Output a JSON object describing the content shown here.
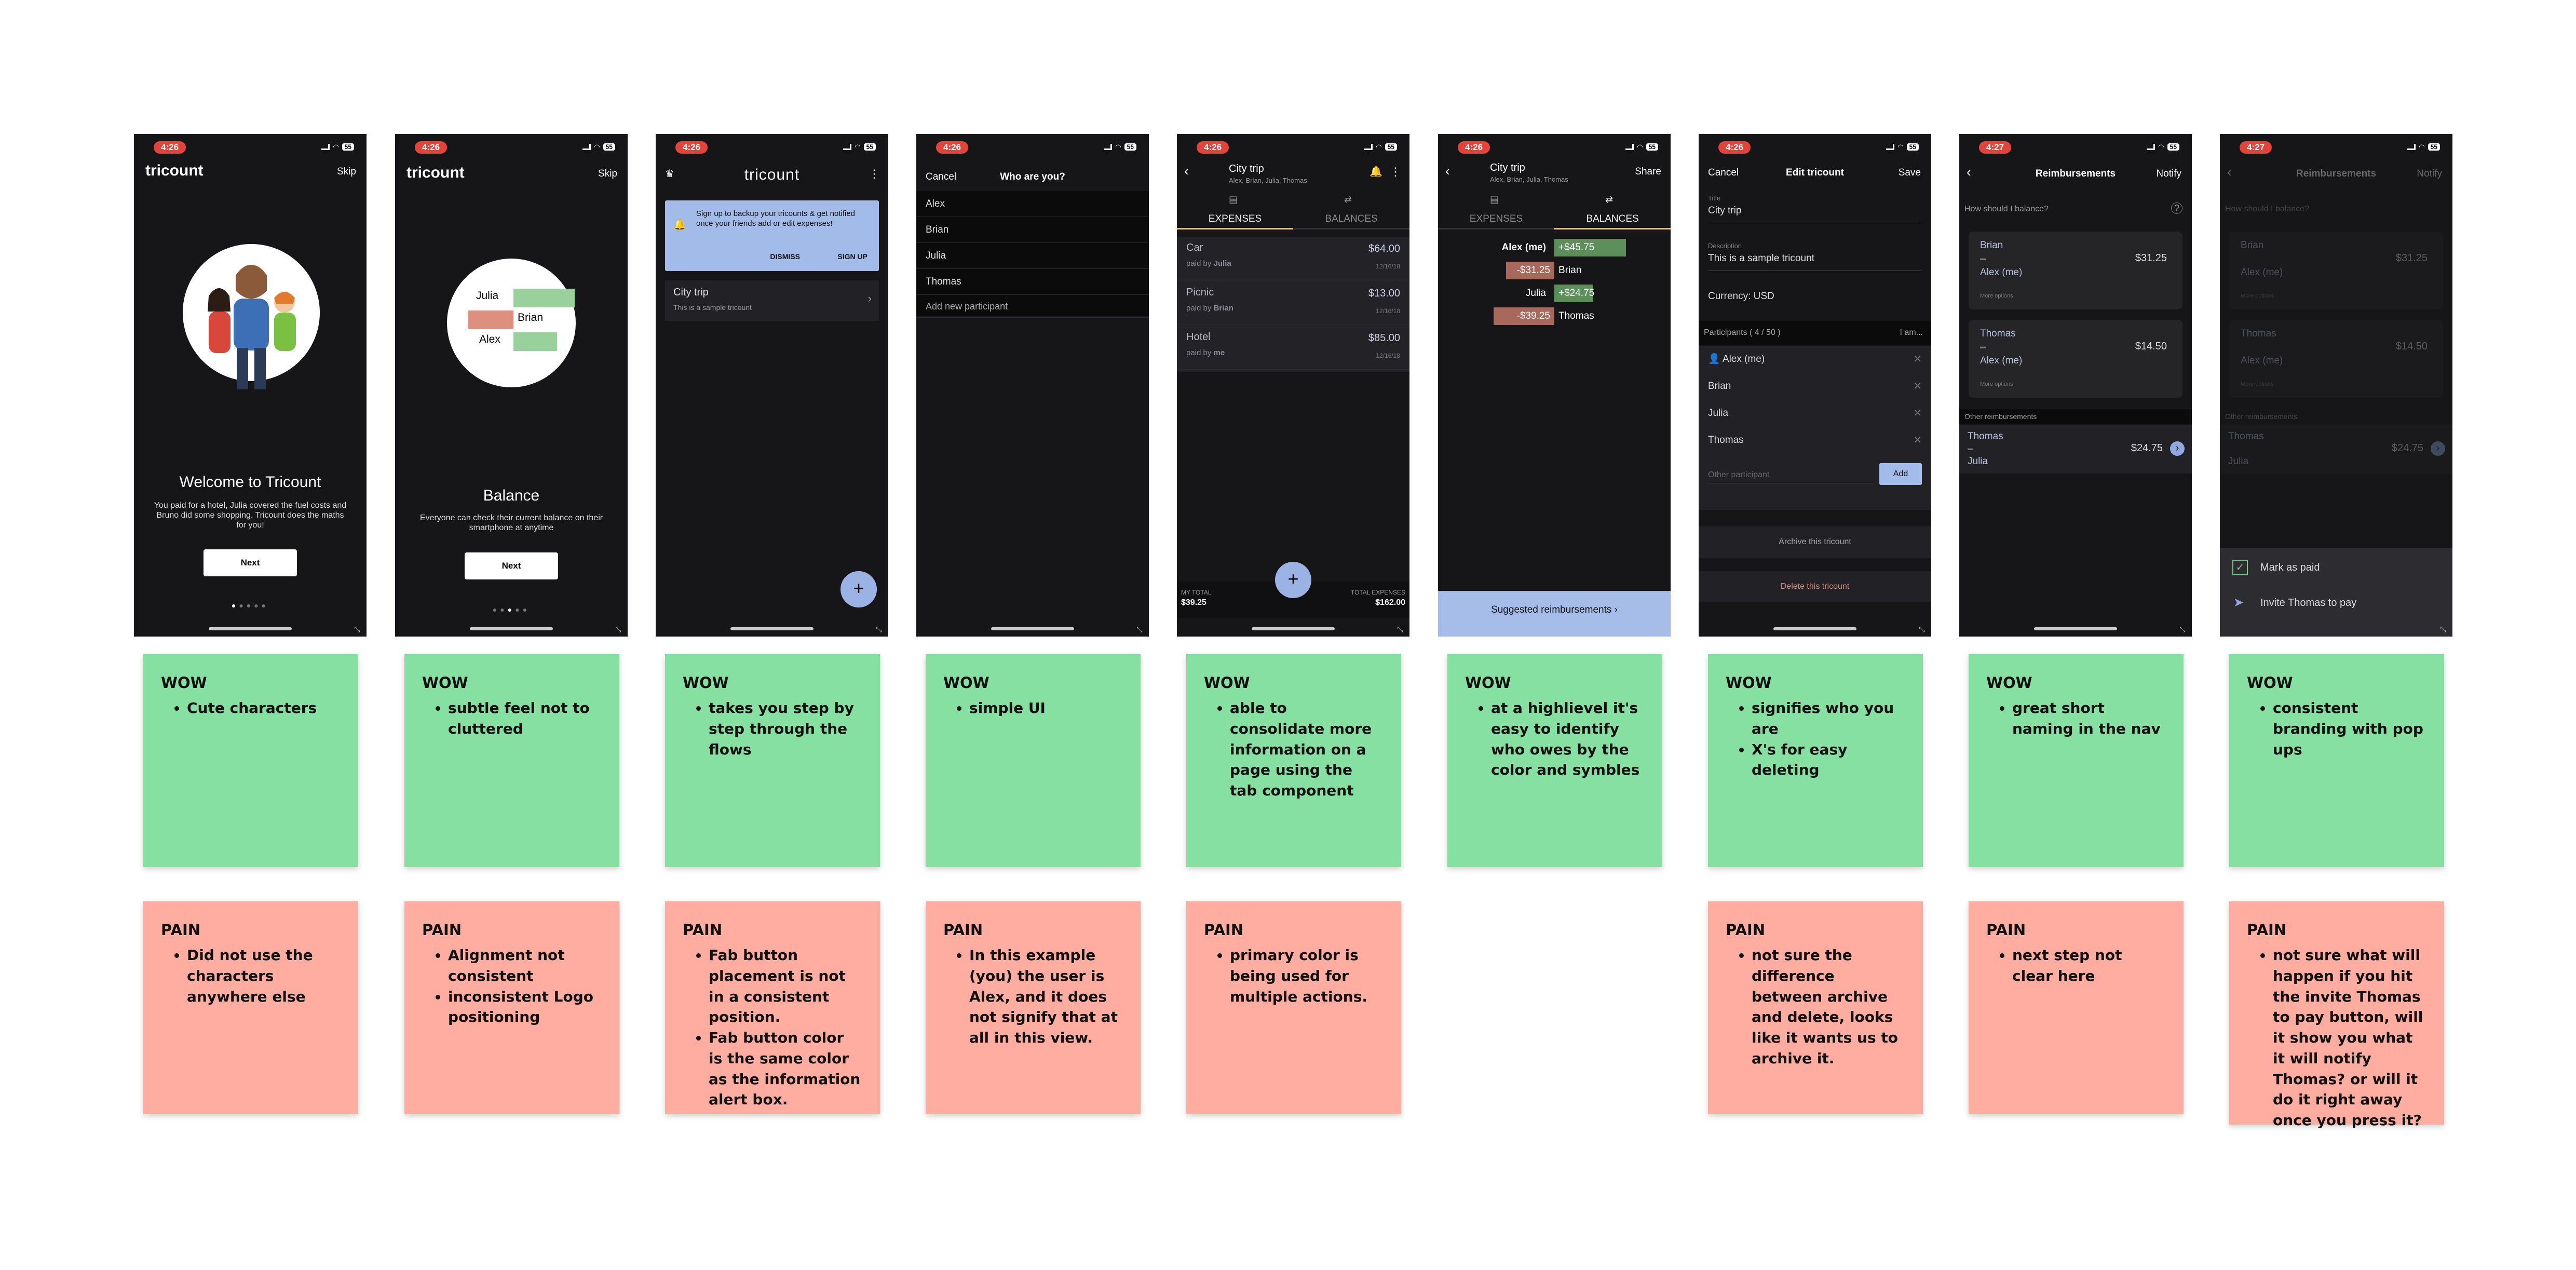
{
  "screens": [
    {
      "time": "4:26",
      "logo": "tricount",
      "skip": "Skip",
      "heading": "Welcome to Tricount",
      "body": "You paid for a hotel, Julia covered the fuel costs and Bruno did some shopping. Tricount does the maths for you!",
      "button": "Next"
    },
    {
      "time": "4:26",
      "logo": "tricount",
      "skip": "Skip",
      "names": [
        "Julia",
        "Brian",
        "Alex"
      ],
      "heading": "Balance",
      "body": "Everyone can check their current balance on their smartphone at anytime",
      "button": "Next"
    },
    {
      "time": "4:26",
      "logo": "tricount",
      "alert": "Sign up to backup your tricounts & get notified once your friends add or edit expenses!",
      "dismiss": "DISMISS",
      "signup": "SIGN UP",
      "item_title": "City trip",
      "item_sub": "This is a sample tricount"
    },
    {
      "time": "4:26",
      "cancel": "Cancel",
      "title": "Who are you?",
      "people": [
        "Alex",
        "Brian",
        "Julia",
        "Thomas"
      ],
      "add": "Add new participant"
    },
    {
      "time": "4:26",
      "title": "City trip",
      "subtitle": "Alex, Brian, Julia, Thomas",
      "tab_expenses": "EXPENSES",
      "tab_balances": "BALANCES",
      "expenses": [
        {
          "name": "Car",
          "amount": "$64.00",
          "paid_by": "paid by",
          "payer": "Julia",
          "date": "12/16/18"
        },
        {
          "name": "Picnic",
          "amount": "$13.00",
          "paid_by": "paid by",
          "payer": "Brian",
          "date": "12/16/18"
        },
        {
          "name": "Hotel",
          "amount": "$85.00",
          "paid_by": "paid by",
          "payer": "me",
          "date": "12/16/18"
        }
      ],
      "my_total_label": "MY TOTAL",
      "my_total": "$39.25",
      "total_label": "TOTAL EXPENSES",
      "total": "$162.00"
    },
    {
      "time": "4:26",
      "title": "City trip",
      "subtitle": "Alex, Brian, Julia, Thomas",
      "share": "Share",
      "tab_expenses": "EXPENSES",
      "tab_balances": "BALANCES",
      "balances": [
        {
          "name": "Alex (me)",
          "value": "+$45.75",
          "sign": "pos",
          "size": 0.92
        },
        {
          "name": "Brian",
          "value": "-$31.25",
          "sign": "neg",
          "size": 0.62
        },
        {
          "name": "Julia",
          "value": "+$24.75",
          "sign": "pos",
          "size": 0.5
        },
        {
          "name": "Thomas",
          "value": "-$39.25",
          "sign": "neg",
          "size": 0.78
        }
      ],
      "suggested": "Suggested reimbursements"
    },
    {
      "time": "4:26",
      "cancel": "Cancel",
      "title": "Edit tricount",
      "save": "Save",
      "title_label": "Title",
      "title_value": "City trip",
      "desc_label": "Description",
      "desc_value": "This is a sample tricount",
      "currency": "Currency: USD",
      "participants_label": "Participants ( 4 / 50 )",
      "iam": "I am...",
      "participants": [
        "Alex (me)",
        "Brian",
        "Julia",
        "Thomas"
      ],
      "other_placeholder": "Other participant",
      "add": "Add",
      "archive": "Archive this tricount",
      "delete": "Delete this tricount"
    },
    {
      "time": "4:27",
      "title": "Reimbursements",
      "notify": "Notify",
      "question": "How should I balance?",
      "cards": [
        {
          "from": "Brian",
          "to": "Alex (me)",
          "amount": "$31.25",
          "more": "More options"
        },
        {
          "from": "Thomas",
          "to": "Alex (me)",
          "amount": "$14.50",
          "more": "More options"
        }
      ],
      "other_label": "Other reimbursements",
      "other": {
        "from": "Thomas",
        "to": "Julia",
        "amount": "$24.75"
      }
    },
    {
      "time": "4:27",
      "title": "Reimbursements",
      "notify": "Notify",
      "question": "How should I balance?",
      "cards": [
        {
          "from": "Brian",
          "to": "Alex (me)",
          "amount": "$31.25",
          "more": "More options"
        },
        {
          "from": "Thomas",
          "to": "Alex (me)",
          "amount": "$14.50",
          "more": "More options"
        }
      ],
      "other_label": "Other reimbursements",
      "other": {
        "from": "Thomas",
        "to": "Julia",
        "amount": "$24.75"
      },
      "sheet": [
        "Mark as paid",
        "Invite Thomas to pay"
      ]
    }
  ],
  "notes": [
    {
      "wow_title": "WOW",
      "wow": [
        "Cute characters"
      ],
      "pain_title": "PAIN",
      "pain": [
        "Did not use the characters anywhere else"
      ]
    },
    {
      "wow_title": "WOW",
      "wow": [
        "subtle feel not to cluttered"
      ],
      "pain_title": "PAIN",
      "pain": [
        "Alignment not consistent",
        "inconsistent Logo positioning"
      ]
    },
    {
      "wow_title": "WOW",
      "wow": [
        "takes you step by step through the flows"
      ],
      "pain_title": "PAIN",
      "pain": [
        "Fab button placement is not in a consistent position.",
        "Fab button color is the same color as the information alert box."
      ]
    },
    {
      "wow_title": "WOW",
      "wow": [
        "simple UI"
      ],
      "pain_title": "PAIN",
      "pain": [
        "In this example (you) the user is Alex, and it does not signify that at all in this view."
      ]
    },
    {
      "wow_title": "WOW",
      "wow": [
        "able to consolidate more information on a page using the tab component"
      ],
      "pain_title": "PAIN",
      "pain": [
        "primary color is being used for multiple actions."
      ]
    },
    {
      "wow_title": "WOW",
      "wow": [
        "at a highlievel it's easy to identify who owes by the color and symbles"
      ]
    },
    {
      "wow_title": "WOW",
      "wow": [
        "signifies who you are",
        "X's for easy deleting"
      ],
      "pain_title": "PAIN",
      "pain": [
        "not sure the difference between archive and delete, looks like it wants us to archive it."
      ]
    },
    {
      "wow_title": "WOW",
      "wow": [
        "great short naming in the nav"
      ],
      "pain_title": "PAIN",
      "pain": [
        "next step not clear here"
      ]
    },
    {
      "wow_title": "WOW",
      "wow": [
        "consistent branding with pop ups"
      ],
      "pain_title": "PAIN",
      "pain": [
        "not sure what will happen if you hit the invite Thomas to pay button, will it show you what it will notify Thomas? or will it do it right away once you press it?"
      ]
    }
  ],
  "colors": {
    "wow": "#86e0a2",
    "pain": "#ffada0",
    "phone_bg": "#161618",
    "accent_blue": "#9bb3e4",
    "positive": "#5d8f5a",
    "negative": "#a8685c",
    "tab_indicator": "#f0c24e"
  },
  "status_icons": {
    "battery": "55"
  }
}
